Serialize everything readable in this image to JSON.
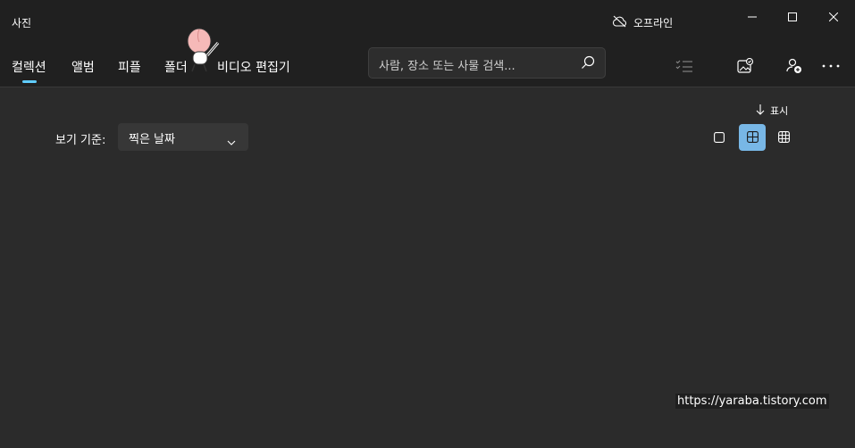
{
  "app": {
    "title": "사진",
    "offline_label": "오프라인"
  },
  "nav": {
    "tabs": [
      {
        "label": "컬렉션",
        "active": true
      },
      {
        "label": "앨범"
      },
      {
        "label": "피플"
      },
      {
        "label": "폴더"
      },
      {
        "label": "비디오 편집기"
      }
    ],
    "search_placeholder": "사람, 장소 또는 사물 검색...",
    "icons": [
      "checklist-icon",
      "import-photo-icon",
      "add-person-icon",
      "more-icon"
    ]
  },
  "toolbar": {
    "view_by_label": "보기 기준:",
    "view_by_value": "찍은 날짜",
    "show_label": "표시",
    "view_size_selected": "medium"
  },
  "watermark": "https://yaraba.tistory.com",
  "colors": {
    "background": "#2b2b2b",
    "titlebar": "#202020",
    "accent": "#60cdff",
    "selected_view": "#78b7e6"
  }
}
